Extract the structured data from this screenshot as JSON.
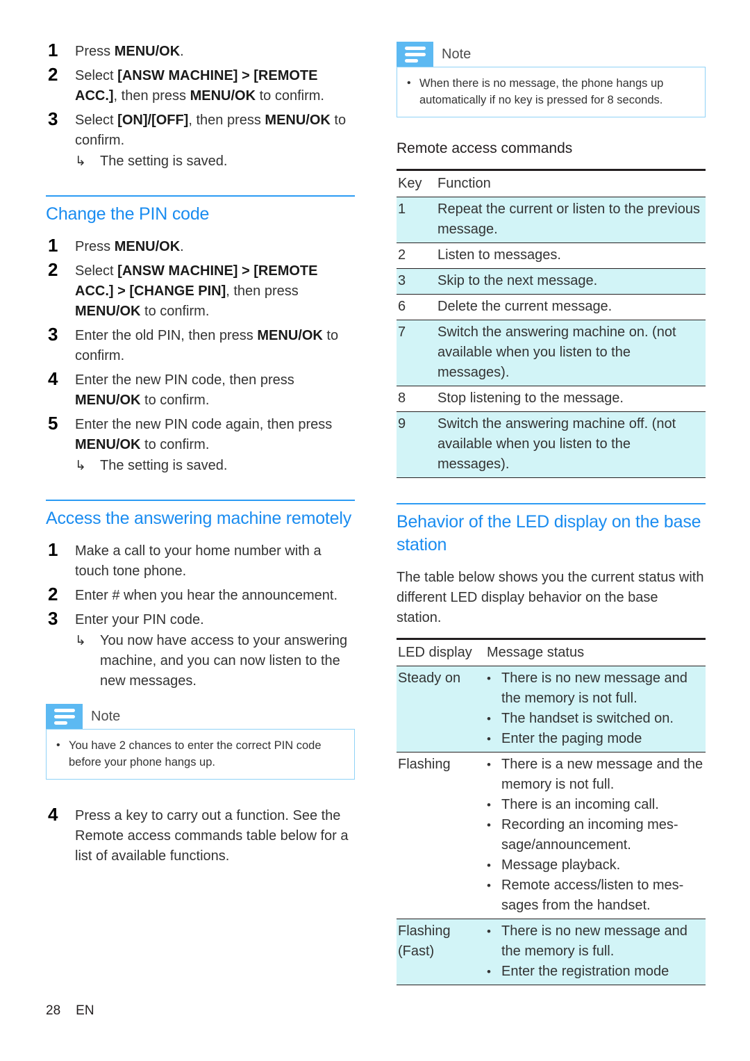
{
  "page": {
    "number": "28",
    "language": "EN"
  },
  "left_column": {
    "steps_remote_access": [
      {
        "num": "1",
        "text": "Press MENU/OK."
      },
      {
        "num": "2",
        "text": "Select [ANSW MACHINE] > [REMOTE ACC.], then press MENU/OK to confirm."
      },
      {
        "num": "3",
        "text": "Select [ON]/[OFF], then press MENU/OK to confirm."
      }
    ],
    "result_setting_saved_1": "The setting is saved.",
    "heading_change_pin": "Change the PIN code",
    "steps_change_pin": [
      {
        "num": "1",
        "text": "Press MENU/OK."
      },
      {
        "num": "2",
        "text": "Select [ANSW MACHINE] > [REMOTE ACC.] > [CHANGE PIN], then press MENU/OK to confirm."
      },
      {
        "num": "3",
        "text": "Enter the old PIN, then press MENU/OK to confirm."
      },
      {
        "num": "4",
        "text": "Enter the new PIN code, then press MENU/OK to confirm."
      },
      {
        "num": "5",
        "text": "Enter the new PIN code again, then press MENU/OK to confirm."
      }
    ],
    "result_setting_saved_2": "The setting is saved.",
    "heading_access_remotely": "Access the answering machine remotely",
    "steps_access_remotely": [
      {
        "num": "1",
        "text": "Make a call to your home number with a touch tone phone."
      },
      {
        "num": "2",
        "text": "Enter # when you hear the announcement."
      },
      {
        "num": "3",
        "text": "Enter your PIN code."
      }
    ],
    "result_access_granted": "You now have access to your answering machine, and you can now listen to the new messages.",
    "note": {
      "title": "Note",
      "items": [
        "You have 2 chances to enter the correct PIN code before your phone hangs up."
      ]
    },
    "step_4": {
      "num": "4",
      "text": "Press a key to carry out a function. See the Remote access commands table below for a list of available functions."
    }
  },
  "right_column": {
    "note": {
      "title": "Note",
      "items": [
        "When there is no message, the phone hangs up automatically if no key is pressed for 8 seconds."
      ]
    },
    "heading_remote_commands": "Remote access commands",
    "remote_commands_table": {
      "headers": [
        "Key",
        "Function"
      ],
      "rows": [
        {
          "key": "1",
          "function": "Repeat the current or listen to the previous message.",
          "shaded": true
        },
        {
          "key": "2",
          "function": "Listen to messages.",
          "shaded": false
        },
        {
          "key": "3",
          "function": "Skip to the next message.",
          "shaded": true
        },
        {
          "key": "6",
          "function": "Delete the current message.",
          "shaded": false
        },
        {
          "key": "7",
          "function": "Switch the answering machine on. (not available when you listen to the messages).",
          "shaded": true
        },
        {
          "key": "8",
          "function": "Stop listening to the message.",
          "shaded": false
        },
        {
          "key": "9",
          "function": "Switch the answering machine off. (not available when you listen to the messages).",
          "shaded": true
        }
      ]
    },
    "heading_led_behavior": "Behavior of the LED display on the base station",
    "led_intro": "The table below shows you the current status with different LED display behavior on the base station.",
    "led_table": {
      "headers": [
        "LED display",
        "Message status"
      ],
      "rows": [
        {
          "led": "Steady on",
          "statuses": [
            "There is no new message and the memory is not full.",
            "The handset is switched on.",
            "Enter the paging mode"
          ],
          "shaded": true
        },
        {
          "led": "Flashing",
          "statuses": [
            "There is a new message and the memory is not full.",
            "There is an incoming call.",
            "Recording an incoming mes-sage/announcement.",
            "Message playback.",
            "Remote access/listen to mes-sages from the handset."
          ],
          "shaded": false
        },
        {
          "led": "Flashing (Fast)",
          "statuses": [
            "There is no new message and the memory is full.",
            "Enter the registration mode"
          ],
          "shaded": true
        }
      ]
    }
  },
  "icons": {
    "note_icon": "note-lines-icon",
    "result_arrow": "↳",
    "bullet": "•"
  },
  "colors": {
    "heading_blue": "#1a8cf0",
    "rule_blue": "#2b9bf4",
    "note_icon_bg": "#5cb9f2",
    "note_border": "#8fd2f7",
    "table_shade": "#d2f4f7",
    "text": "#333333"
  }
}
